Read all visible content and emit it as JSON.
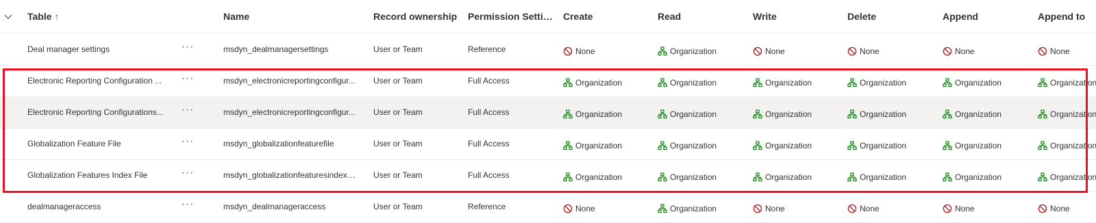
{
  "columns": {
    "table": "Table",
    "table_sort": "↑",
    "name": "Name",
    "record_ownership": "Record ownership",
    "permission_settings": "Permission Setti…",
    "create": "Create",
    "read": "Read",
    "write": "Write",
    "delete": "Delete",
    "append": "Append",
    "append_to": "Append to"
  },
  "more_label": "···",
  "rows": [
    {
      "table": "Deal manager settings",
      "name": "msdyn_dealmanagersettings",
      "ownership": "User or Team",
      "permission": "Reference",
      "create": "None",
      "read": "Organization",
      "write": "None",
      "delete": "None",
      "append": "None",
      "append_to": "None"
    },
    {
      "table": "Electronic Reporting Configuration ...",
      "name": "msdyn_electronicreportingconfigur...",
      "ownership": "User or Team",
      "permission": "Full Access",
      "create": "Organization",
      "read": "Organization",
      "write": "Organization",
      "delete": "Organization",
      "append": "Organization",
      "append_to": "Organization"
    },
    {
      "table": "Electronic Reporting Configurations...",
      "name": "msdyn_electronicreportingconfigur...",
      "ownership": "User or Team",
      "permission": "Full Access",
      "create": "Organization",
      "read": "Organization",
      "write": "Organization",
      "delete": "Organization",
      "append": "Organization",
      "append_to": "Organization"
    },
    {
      "table": "Globalization Feature File",
      "name": "msdyn_globalizationfeaturefile",
      "ownership": "User or Team",
      "permission": "Full Access",
      "create": "Organization",
      "read": "Organization",
      "write": "Organization",
      "delete": "Organization",
      "append": "Organization",
      "append_to": "Organization"
    },
    {
      "table": "Globalization Features Index File",
      "name": "msdyn_globalizationfeaturesindexfile",
      "ownership": "User or Team",
      "permission": "Full Access",
      "create": "Organization",
      "read": "Organization",
      "write": "Organization",
      "delete": "Organization",
      "append": "Organization",
      "append_to": "Organization"
    },
    {
      "table": "dealmanageraccess",
      "name": "msdyn_dealmanageraccess",
      "ownership": "User or Team",
      "permission": "Reference",
      "create": "None",
      "read": "Organization",
      "write": "None",
      "delete": "None",
      "append": "None",
      "append_to": "None"
    }
  ],
  "colors": {
    "organization_icon": "#107c10",
    "none_icon": "#a4262c",
    "highlight": "#e81123",
    "row_hover": "#f3f2f1"
  }
}
